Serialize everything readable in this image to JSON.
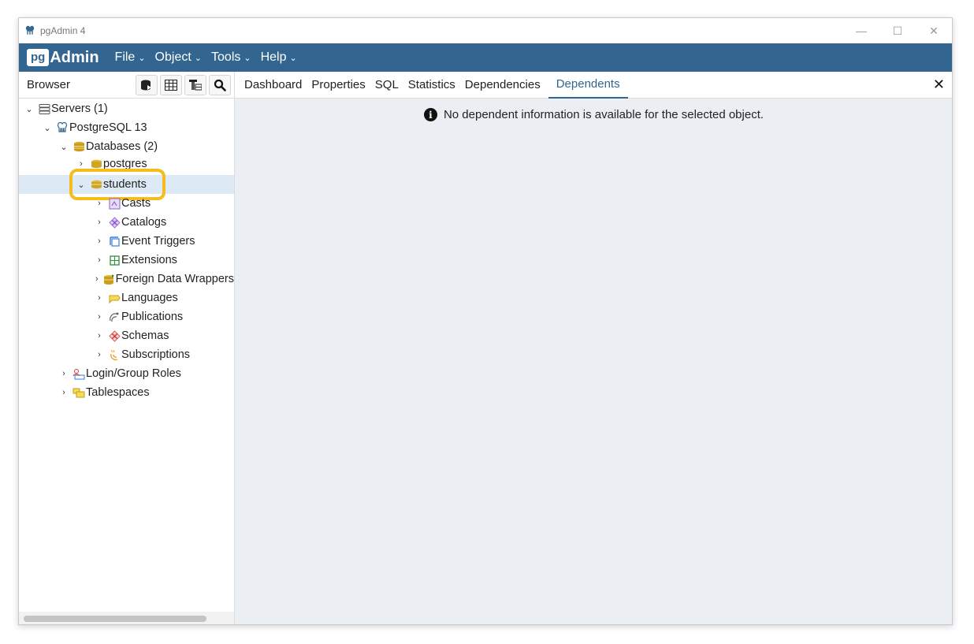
{
  "window": {
    "title": "pgAdmin 4",
    "controls": [
      "—",
      "☐",
      "✕"
    ]
  },
  "menubar": {
    "brand_pg": "pg",
    "brand_admin": "Admin",
    "items": [
      {
        "label": "File",
        "chevron": "⌄"
      },
      {
        "label": "Object",
        "chevron": "⌄"
      },
      {
        "label": "Tools",
        "chevron": "⌄"
      },
      {
        "label": "Help",
        "chevron": "⌄"
      }
    ]
  },
  "browser": {
    "title": "Browser",
    "toolbar_icons": [
      "query-tool-icon",
      "table-view-icon",
      "filter-table-icon",
      "search-icon"
    ],
    "tree": [
      {
        "label": "Servers (1)",
        "toggle": "⌄",
        "icon": "servers-icon"
      },
      {
        "label": "PostgreSQL 13",
        "toggle": "⌄",
        "icon": "postgres-elephant-icon"
      },
      {
        "label": "Databases (2)",
        "toggle": "⌄",
        "icon": "databases-icon"
      },
      {
        "label": "postgres",
        "toggle": "›",
        "icon": "database-icon"
      },
      {
        "label": "students",
        "toggle": "⌄",
        "icon": "database-icon",
        "selected": true
      },
      {
        "label": "Casts",
        "toggle": "›",
        "icon": "casts-icon"
      },
      {
        "label": "Catalogs",
        "toggle": "›",
        "icon": "catalogs-icon"
      },
      {
        "label": "Event Triggers",
        "toggle": "›",
        "icon": "event-triggers-icon"
      },
      {
        "label": "Extensions",
        "toggle": "›",
        "icon": "extensions-icon"
      },
      {
        "label": "Foreign Data Wrappers",
        "toggle": "›",
        "icon": "foreign-data-wrappers-icon"
      },
      {
        "label": "Languages",
        "toggle": "›",
        "icon": "languages-icon"
      },
      {
        "label": "Publications",
        "toggle": "›",
        "icon": "publications-icon"
      },
      {
        "label": "Schemas",
        "toggle": "›",
        "icon": "schemas-icon"
      },
      {
        "label": "Subscriptions",
        "toggle": "›",
        "icon": "subscriptions-icon"
      },
      {
        "label": "Login/Group Roles",
        "toggle": "›",
        "icon": "login-roles-icon"
      },
      {
        "label": "Tablespaces",
        "toggle": "›",
        "icon": "tablespaces-icon"
      }
    ]
  },
  "main": {
    "tabs": [
      {
        "label": "Dashboard"
      },
      {
        "label": "Properties"
      },
      {
        "label": "SQL"
      },
      {
        "label": "Statistics"
      },
      {
        "label": "Dependencies"
      },
      {
        "label": "Dependents",
        "active": true
      }
    ],
    "close_label": "✕",
    "message": "No dependent information is available for the selected object.",
    "info_icon_glyph": "i"
  },
  "colors": {
    "header_blue": "#326690",
    "selection": "#dde9f4",
    "highlight_ring": "#f4bc1c",
    "content_bg": "#ebeef3"
  }
}
